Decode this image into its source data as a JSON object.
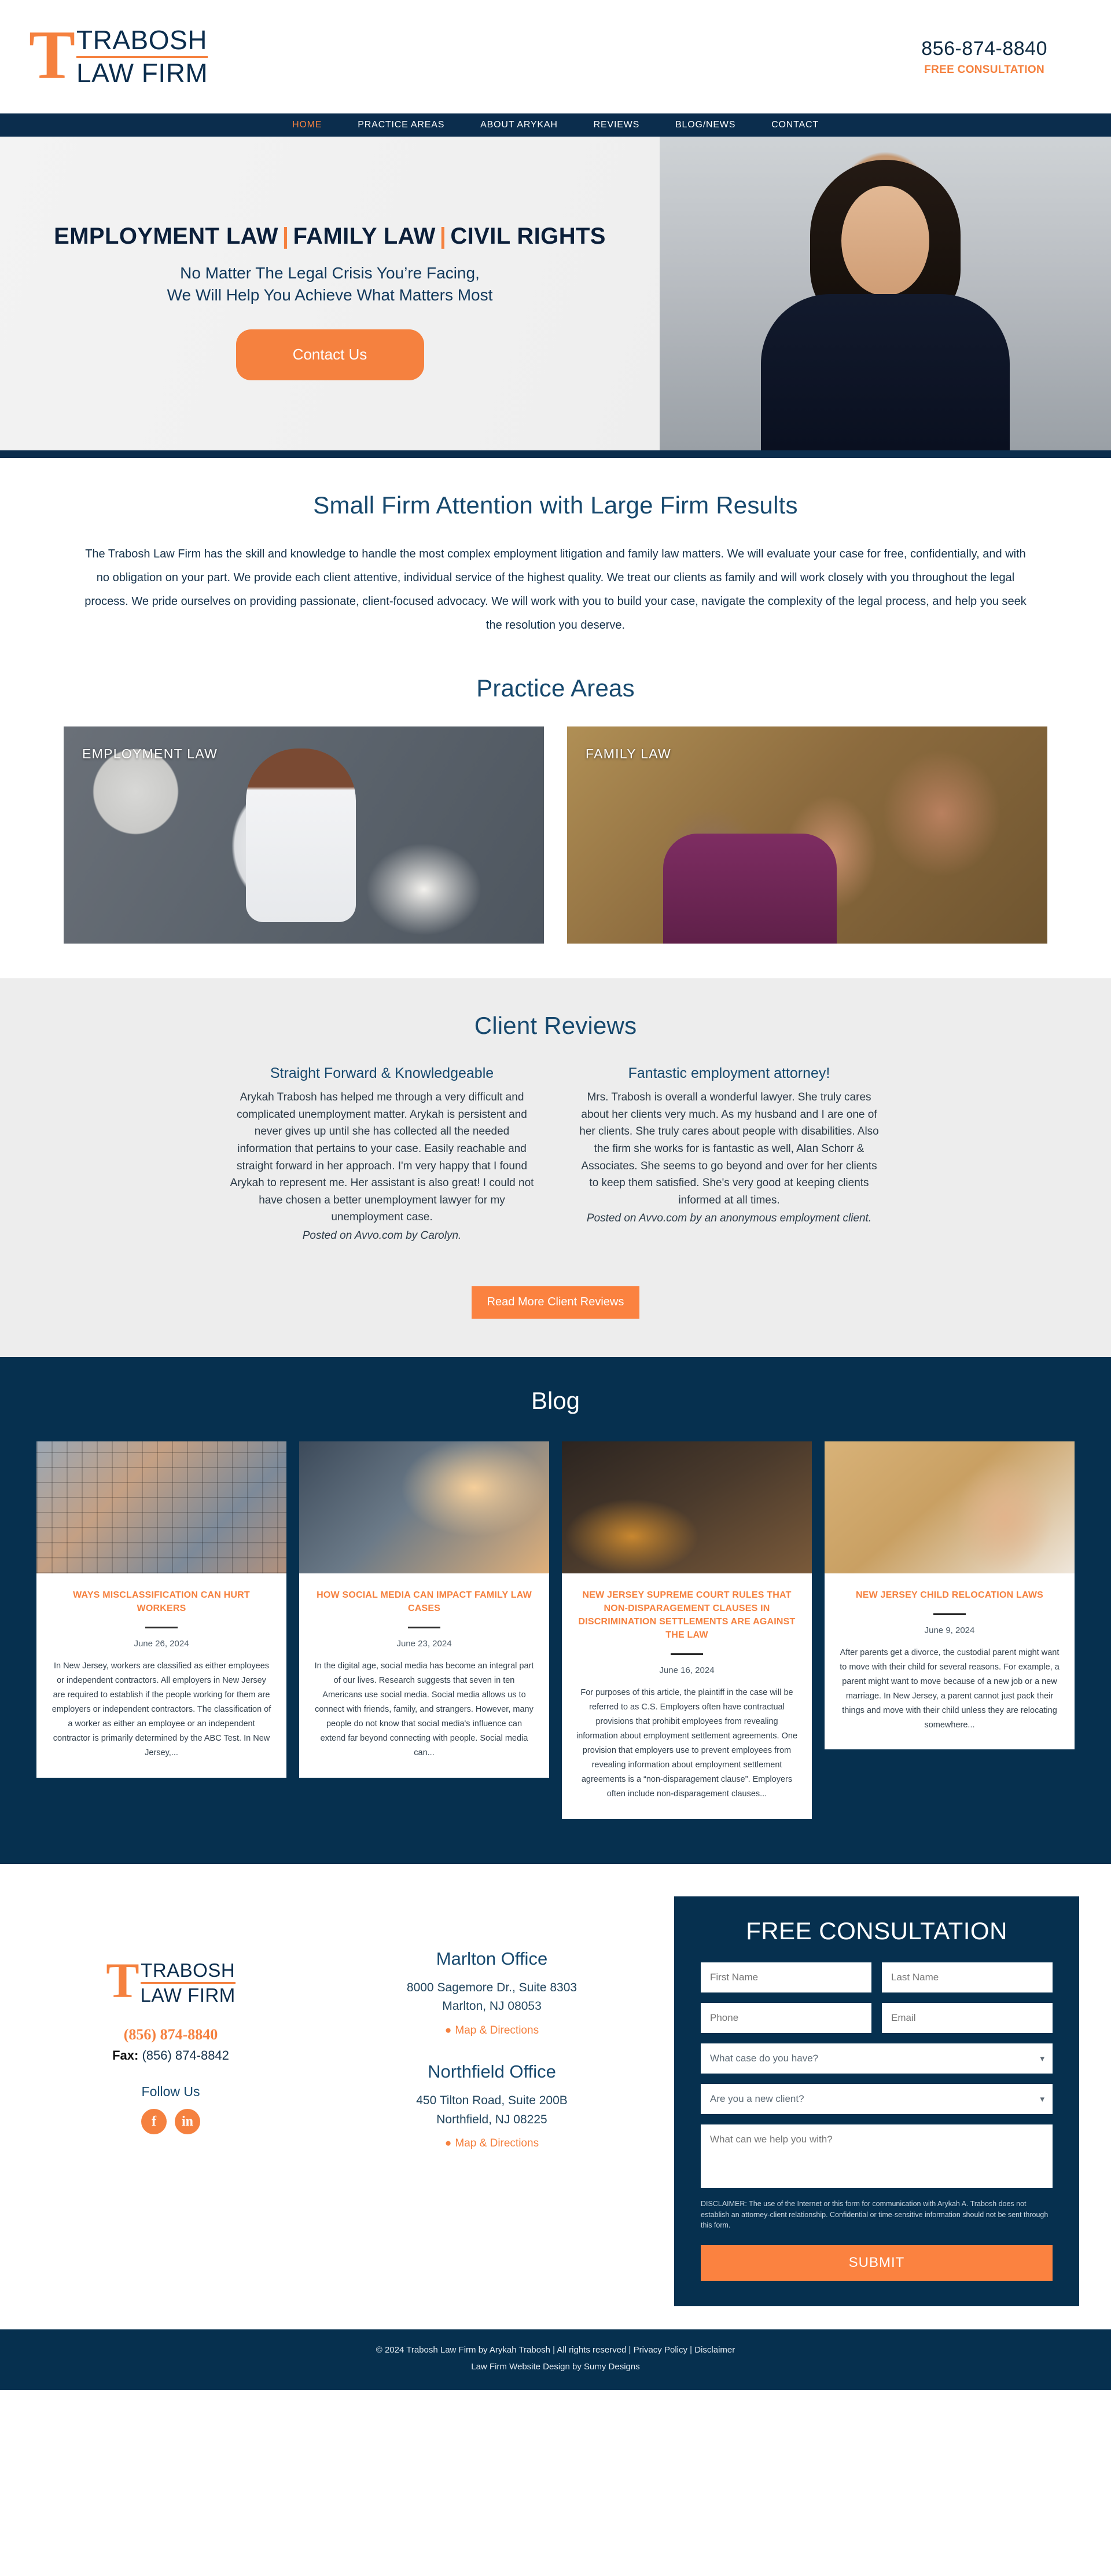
{
  "brand": {
    "logo_letter": "T",
    "line1": "TRABOSH",
    "line2": "LAW FIRM",
    "accent_orange": "#f5813f",
    "navy": "#06304f"
  },
  "header": {
    "phone": "856-874-8840",
    "cta": "FREE CONSULTATION"
  },
  "nav": {
    "items": [
      {
        "label": "HOME",
        "active": true
      },
      {
        "label": "PRACTICE AREAS",
        "active": false
      },
      {
        "label": "ABOUT ARYKAH",
        "active": false
      },
      {
        "label": "REVIEWS",
        "active": false
      },
      {
        "label": "BLOG/NEWS",
        "active": false
      },
      {
        "label": "CONTACT",
        "active": false
      }
    ]
  },
  "hero": {
    "title_part1": "EMPLOYMENT LAW",
    "title_sep1": "|",
    "title_part2": "FAMILY LAW",
    "title_sep2": "|",
    "title_part3": "CIVIL RIGHTS",
    "sub_line1": "No Matter The Legal Crisis You’re Facing,",
    "sub_line2": "We Will Help You Achieve What Matters Most",
    "button": "Contact Us"
  },
  "intro": {
    "heading": "Small Firm Attention with Large Firm Results",
    "paragraph": "The Trabosh Law Firm has the skill and knowledge to handle the most complex employment litigation and family law matters. We will evaluate your case for free, confidentially, and with no obligation on your part. We provide each client attentive, individual service of the highest quality. We treat our clients as family and will work closely with you throughout the legal process. We pride ourselves on providing passionate, client-focused advocacy. We will work with you to build your case, navigate the complexity of the legal process, and help you seek the resolution you deserve."
  },
  "practice_areas": {
    "heading": "Practice Areas",
    "cards": [
      {
        "label": "EMPLOYMENT LAW"
      },
      {
        "label": "FAMILY LAW"
      }
    ]
  },
  "reviews": {
    "heading": "Client Reviews",
    "items": [
      {
        "title": "Straight Forward & Knowledgeable",
        "body": "Arykah Trabosh has helped me through a very difficult and complicated unemployment matter. Arykah is persistent and never gives up until she has collected all the needed information that pertains to your case. Easily reachable and straight forward in her approach. I'm very happy that I found Arykah to represent me. Her assistant is also great! I could not have chosen a better unemployment lawyer for my unemployment case.",
        "source": "Posted on Avvo.com by Carolyn."
      },
      {
        "title": "Fantastic employment attorney!",
        "body": "Mrs. Trabosh is overall a wonderful lawyer. She truly cares about her clients very much. As my husband and I are one of her clients. She truly cares about people with disabilities. Also the firm she works for is fantastic as well, Alan Schorr & Associates. She seems to go beyond and over for her clients to keep them satisfied. She's very good at keeping clients informed at all times.",
        "source": "Posted on Avvo.com by an anonymous employment client."
      }
    ],
    "button": "Read More Client Reviews"
  },
  "blog": {
    "heading": "Blog",
    "posts": [
      {
        "title": "WAYS MISCLASSIFICATION CAN HURT WORKERS",
        "date": "June 26, 2024",
        "excerpt": "In New Jersey, workers are classified as either employees or independent contractors. All employers in New Jersey are required to establish if the people working for them are employers or independent contractors. The classification of a worker as either an employee or an independent contractor is primarily determined by the ABC Test. In New Jersey,..."
      },
      {
        "title": "HOW SOCIAL MEDIA CAN IMPACT FAMILY LAW CASES",
        "date": "June 23, 2024",
        "excerpt": "In the digital age, social media has become an integral part of our lives. Research suggests that seven in ten Americans use social media. Social media allows us to connect with friends, family, and strangers. However, many people do not know that social media's influence can extend far beyond connecting with people. Social media can..."
      },
      {
        "title": "NEW JERSEY SUPREME COURT RULES THAT NON-DISPARAGEMENT CLAUSES IN DISCRIMINATION SETTLEMENTS ARE AGAINST THE LAW",
        "date": "June 16, 2024",
        "excerpt": "For purposes of this article, the plaintiff in the case will be referred to as C.S. Employers often have contractual provisions that prohibit employees from revealing information about employment settlement agreements. One provision that employers use to prevent employees from revealing information about employment settlement agreements is a “non-disparagement clause”. Employers often include non-disparagement clauses..."
      },
      {
        "title": "NEW JERSEY CHILD RELOCATION LAWS",
        "date": "June 9, 2024",
        "excerpt": "After parents get a divorce, the custodial parent might want to move with their child for several reasons. For example, a parent might want to move because of a new job or a new marriage. In New Jersey, a parent cannot just pack their things and move with their child unless they are relocating somewhere..."
      }
    ]
  },
  "footer": {
    "phone": "(856) 874-8840",
    "fax_label": "Fax:",
    "fax": "(856) 874-8842",
    "follow": "Follow Us",
    "social": [
      {
        "name": "facebook",
        "glyph": "f"
      },
      {
        "name": "linkedin",
        "glyph": "in"
      }
    ],
    "offices": [
      {
        "name": "Marlton Office",
        "line1": "8000 Sagemore Dr., Suite 8303",
        "line2": "Marlton, NJ 08053",
        "map_link": "Map & Directions"
      },
      {
        "name": "Northfield Office",
        "line1": "450 Tilton Road, Suite 200B",
        "line2": "Northfield, NJ 08225",
        "map_link": "Map & Directions"
      }
    ],
    "form": {
      "heading": "FREE CONSULTATION",
      "first_name_placeholder": "First Name",
      "last_name_placeholder": "Last Name",
      "phone_placeholder": "Phone",
      "email_placeholder": "Email",
      "case_type_selected": "What case do you have?",
      "case_type_options": [
        "What case do you have?"
      ],
      "new_client_selected": "Are you a new client?",
      "new_client_options": [
        "Are you a new client?"
      ],
      "message_placeholder": "What can we help you with?",
      "disclaimer": "DISCLAIMER: The use of the Internet or this form for communication with Arykah A. Trabosh does not establish an attorney-client relationship. Confidential or time-sensitive information should not be sent through this form.",
      "submit": "SUBMIT"
    },
    "bottom_copyright": "© 2024 Trabosh Law Firm by Arykah Trabosh | All rights reserved |",
    "bottom_privacy": "Privacy Policy",
    "bottom_sep": "|",
    "bottom_disclaimer": "Disclaimer",
    "bottom_credit": "Law Firm Website Design by Sumy Designs"
  }
}
